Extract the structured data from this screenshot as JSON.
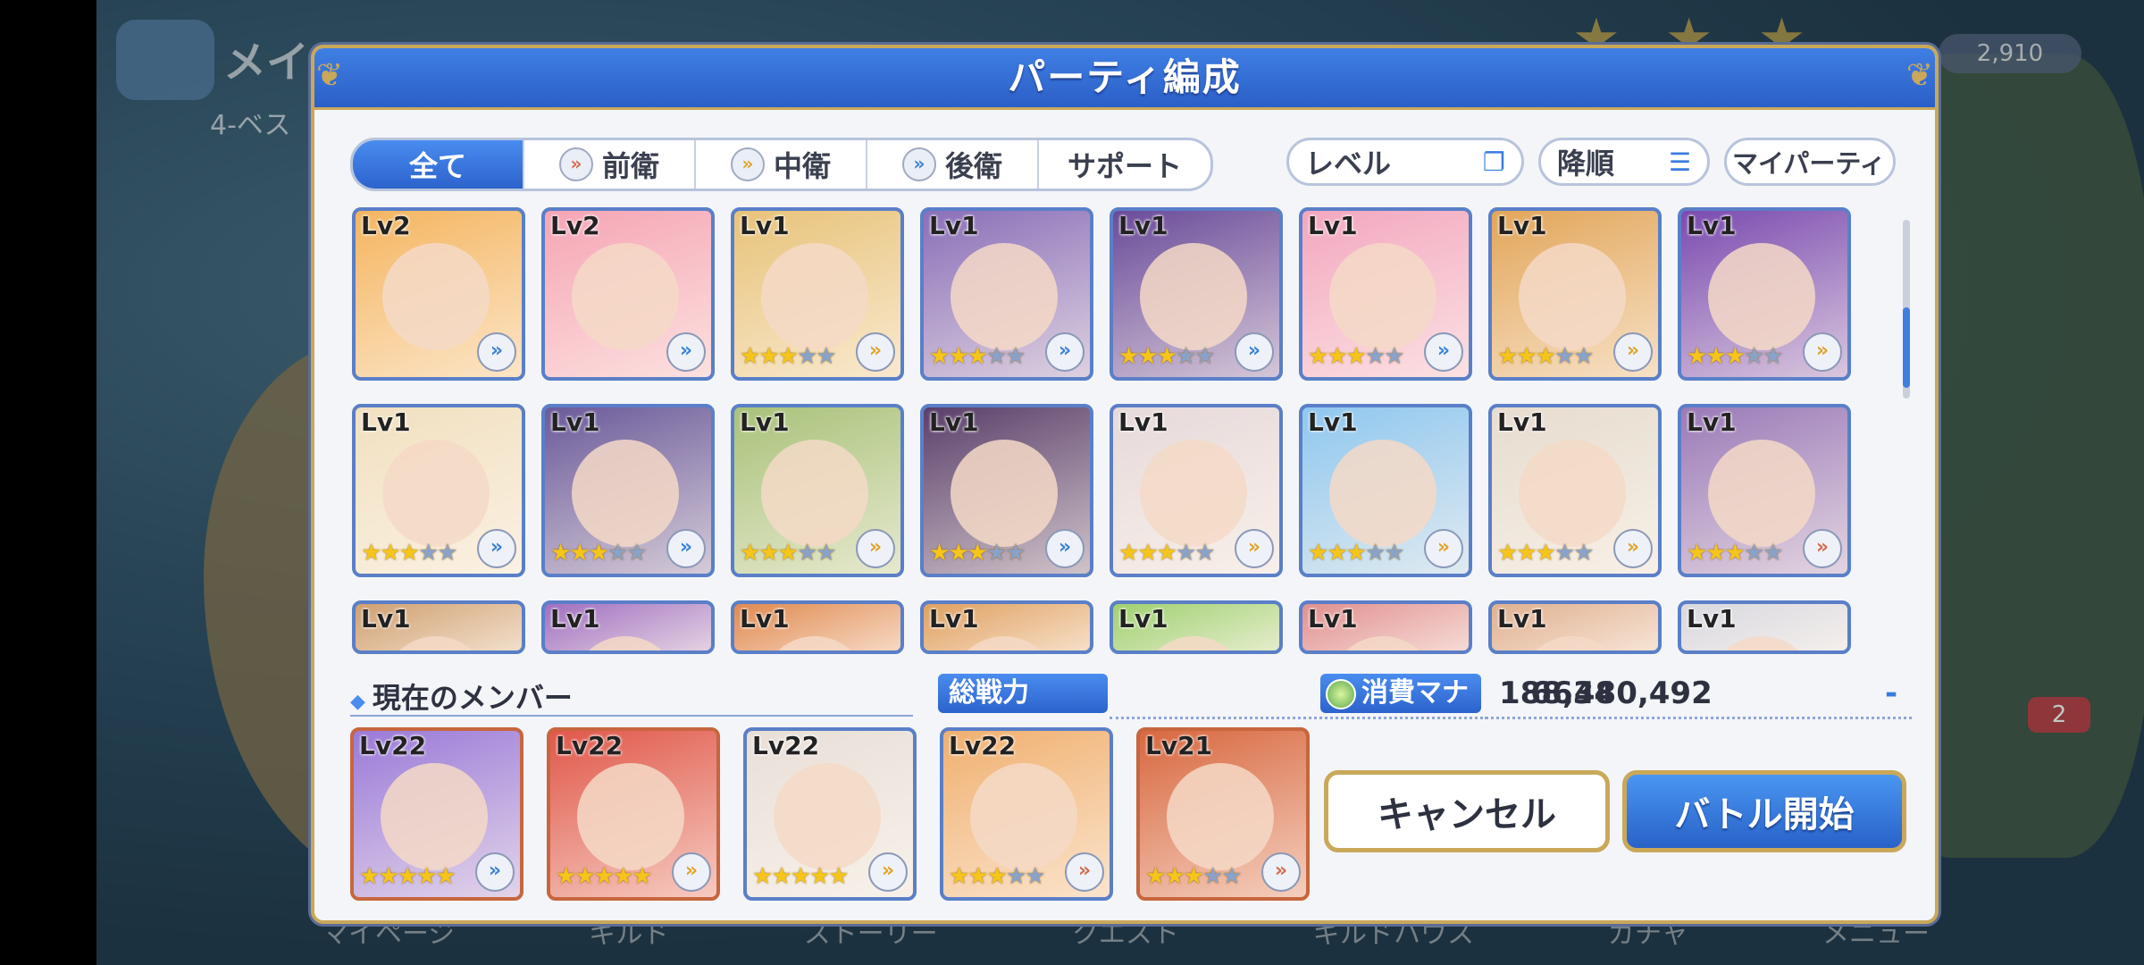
{
  "background": {
    "title": "メイ",
    "subtitle": "4-ベス",
    "gold": "2,910",
    "nav_items": [
      "マイページ",
      "ギルド",
      "ストーリー",
      "クエスト",
      "ギルドハウス",
      "ガチャ",
      "メニュー"
    ],
    "badge": "2"
  },
  "dialog": {
    "title": "パーティ編成"
  },
  "filters": {
    "tabs": [
      {
        "label": "全て",
        "role": ""
      },
      {
        "label": "前衛",
        "role": "front"
      },
      {
        "label": "中衛",
        "role": "mid"
      },
      {
        "label": "後衛",
        "role": "back"
      },
      {
        "label": "サポート",
        "role": ""
      }
    ],
    "sort_label": "レベル",
    "order_label": "降順",
    "my_party_label": "マイパーティ"
  },
  "roster": [
    {
      "level": "Lv2",
      "stars": 0,
      "max": 0,
      "role": "back",
      "color": "#f4b560"
    },
    {
      "level": "Lv2",
      "stars": 0,
      "max": 0,
      "role": "back",
      "color": "#f5a5b5"
    },
    {
      "level": "Lv1",
      "stars": 3,
      "max": 5,
      "role": "mid",
      "color": "#e8c37a"
    },
    {
      "level": "Lv1",
      "stars": 3,
      "max": 5,
      "role": "back",
      "color": "#8a6fb8"
    },
    {
      "level": "Lv1",
      "stars": 3,
      "max": 5,
      "role": "back",
      "color": "#6a4b9a"
    },
    {
      "level": "Lv1",
      "stars": 3,
      "max": 5,
      "role": "back",
      "color": "#f3a7bf"
    },
    {
      "level": "Lv1",
      "stars": 3,
      "max": 5,
      "role": "mid",
      "color": "#e2a65a"
    },
    {
      "level": "Lv1",
      "stars": 3,
      "max": 5,
      "role": "mid",
      "color": "#7a4bb0"
    },
    {
      "level": "Lv1",
      "stars": 3,
      "max": 5,
      "role": "back",
      "color": "#f1e0c0"
    },
    {
      "level": "Lv1",
      "stars": 3,
      "max": 5,
      "role": "back",
      "color": "#6b5a9a"
    },
    {
      "level": "Lv1",
      "stars": 3,
      "max": 5,
      "role": "mid",
      "color": "#a9c27a"
    },
    {
      "level": "Lv1",
      "stars": 3,
      "max": 5,
      "role": "back",
      "color": "#5a3f6a"
    },
    {
      "level": "Lv1",
      "stars": 3,
      "max": 5,
      "role": "mid",
      "color": "#e6dada"
    },
    {
      "level": "Lv1",
      "stars": 3,
      "max": 5,
      "role": "mid",
      "color": "#8fc7ef"
    },
    {
      "level": "Lv1",
      "stars": 3,
      "max": 5,
      "role": "mid",
      "color": "#e6dccf"
    },
    {
      "level": "Lv1",
      "stars": 3,
      "max": 5,
      "role": "front",
      "color": "#9a7ab8"
    },
    {
      "level": "Lv1",
      "stars": 0,
      "max": 0,
      "role": "",
      "color": "#d0a070"
    },
    {
      "level": "Lv1",
      "stars": 0,
      "max": 0,
      "role": "",
      "color": "#a070c0"
    },
    {
      "level": "Lv1",
      "stars": 0,
      "max": 0,
      "role": "",
      "color": "#e08a50"
    },
    {
      "level": "Lv1",
      "stars": 0,
      "max": 0,
      "role": "",
      "color": "#e0a060"
    },
    {
      "level": "Lv1",
      "stars": 0,
      "max": 0,
      "role": "",
      "color": "#a0d070"
    },
    {
      "level": "Lv1",
      "stars": 0,
      "max": 0,
      "role": "",
      "color": "#e09090"
    },
    {
      "level": "Lv1",
      "stars": 0,
      "max": 0,
      "role": "",
      "color": "#e0b090"
    },
    {
      "level": "Lv1",
      "stars": 0,
      "max": 0,
      "role": "",
      "color": "#d8d8e0"
    }
  ],
  "members": {
    "label": "現在のメンバー",
    "power_label": "総戦力",
    "power_value": "6634",
    "mana_label": "消費マナ",
    "mana_value": "188,480,492",
    "mana_delta": "-",
    "list": [
      {
        "level": "Lv22",
        "stars": 5,
        "max": 5,
        "role": "back",
        "color": "#9a7ad8",
        "frame": "copper"
      },
      {
        "level": "Lv22",
        "stars": 5,
        "max": 5,
        "role": "mid",
        "color": "#e0584a",
        "frame": "copper"
      },
      {
        "level": "Lv22",
        "stars": 5,
        "max": 5,
        "role": "mid",
        "color": "#e8e0d8",
        "frame": "blue"
      },
      {
        "level": "Lv22",
        "stars": 3,
        "max": 5,
        "role": "front",
        "color": "#f0b070",
        "frame": "blue"
      },
      {
        "level": "Lv21",
        "stars": 3,
        "max": 5,
        "role": "front",
        "color": "#d86840",
        "frame": "copper"
      }
    ]
  },
  "actions": {
    "cancel": "キャンセル",
    "start": "バトル開始"
  }
}
